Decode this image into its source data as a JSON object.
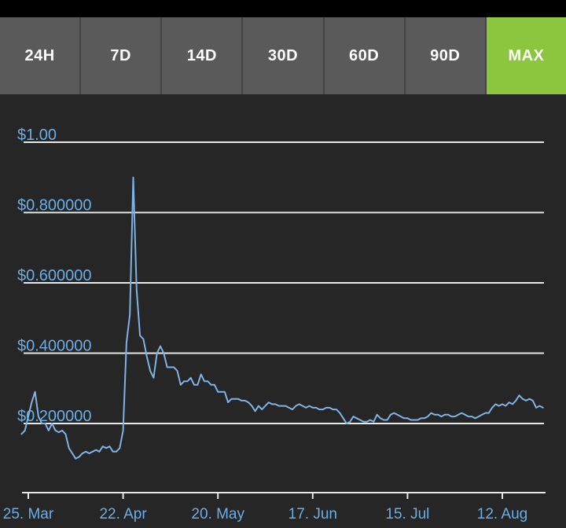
{
  "tabs": [
    {
      "label": "24H",
      "active": false
    },
    {
      "label": "7D",
      "active": false
    },
    {
      "label": "14D",
      "active": false
    },
    {
      "label": "30D",
      "active": false
    },
    {
      "label": "60D",
      "active": false
    },
    {
      "label": "90D",
      "active": false
    },
    {
      "label": "MAX",
      "active": true
    }
  ],
  "colors": {
    "background": "#262626",
    "grid": "#e8e8e8",
    "line": "#7fb2e5",
    "label": "#6aaee8",
    "tab": "#5a5a5a",
    "tab_active": "#8cc63f"
  },
  "chart_data": {
    "type": "line",
    "title": "",
    "xlabel": "",
    "ylabel": "",
    "ylim": [
      0.0,
      1.0
    ],
    "xlim": [
      "2019-03-25",
      "2019-08-24"
    ],
    "grid": true,
    "legend": "none",
    "y_ticks": [
      {
        "value": 1.0,
        "label": "$1.00"
      },
      {
        "value": 0.8,
        "label": "$0.800000"
      },
      {
        "value": 0.6,
        "label": "$0.600000"
      },
      {
        "value": 0.4,
        "label": "$0.400000"
      },
      {
        "value": 0.2,
        "label": "$0.200000"
      }
    ],
    "x_ticks": [
      {
        "date": "2019-03-25",
        "label": "25. Mar"
      },
      {
        "date": "2019-04-22",
        "label": "22. Apr"
      },
      {
        "date": "2019-05-20",
        "label": "20. May"
      },
      {
        "date": "2019-06-17",
        "label": "17. Jun"
      },
      {
        "date": "2019-07-15",
        "label": "15. Jul"
      },
      {
        "date": "2019-08-12",
        "label": "12. Aug"
      }
    ],
    "series": [
      {
        "x": [
          "2019-03-23",
          "2019-03-24",
          "2019-03-25",
          "2019-03-26",
          "2019-03-27",
          "2019-03-28",
          "2019-03-29",
          "2019-03-30",
          "2019-03-31",
          "2019-04-01",
          "2019-04-02",
          "2019-04-03",
          "2019-04-04",
          "2019-04-05",
          "2019-04-06",
          "2019-04-07",
          "2019-04-08",
          "2019-04-09",
          "2019-04-10",
          "2019-04-11",
          "2019-04-12",
          "2019-04-13",
          "2019-04-14",
          "2019-04-15",
          "2019-04-16",
          "2019-04-17",
          "2019-04-18",
          "2019-04-19",
          "2019-04-20",
          "2019-04-21",
          "2019-04-22",
          "2019-04-23",
          "2019-04-24",
          "2019-04-25",
          "2019-04-26",
          "2019-04-27",
          "2019-04-28",
          "2019-04-29",
          "2019-04-30",
          "2019-05-01",
          "2019-05-02",
          "2019-05-03",
          "2019-05-04",
          "2019-05-05",
          "2019-05-06",
          "2019-05-07",
          "2019-05-08",
          "2019-05-09",
          "2019-05-10",
          "2019-05-11",
          "2019-05-12",
          "2019-05-13",
          "2019-05-14",
          "2019-05-15",
          "2019-05-16",
          "2019-05-17",
          "2019-05-18",
          "2019-05-19",
          "2019-05-20",
          "2019-05-21",
          "2019-05-22",
          "2019-05-23",
          "2019-05-24",
          "2019-05-25",
          "2019-05-26",
          "2019-05-27",
          "2019-05-28",
          "2019-05-29",
          "2019-05-30",
          "2019-05-31",
          "2019-06-01",
          "2019-06-02",
          "2019-06-03",
          "2019-06-04",
          "2019-06-05",
          "2019-06-06",
          "2019-06-07",
          "2019-06-08",
          "2019-06-09",
          "2019-06-10",
          "2019-06-11",
          "2019-06-12",
          "2019-06-13",
          "2019-06-14",
          "2019-06-15",
          "2019-06-16",
          "2019-06-17",
          "2019-06-18",
          "2019-06-19",
          "2019-06-20",
          "2019-06-21",
          "2019-06-22",
          "2019-06-23",
          "2019-06-24",
          "2019-06-25",
          "2019-06-26",
          "2019-06-27",
          "2019-06-28",
          "2019-06-29",
          "2019-06-30",
          "2019-07-01",
          "2019-07-02",
          "2019-07-03",
          "2019-07-04",
          "2019-07-05",
          "2019-07-06",
          "2019-07-07",
          "2019-07-08",
          "2019-07-09",
          "2019-07-10",
          "2019-07-11",
          "2019-07-12",
          "2019-07-13",
          "2019-07-14",
          "2019-07-15",
          "2019-07-16",
          "2019-07-17",
          "2019-07-18",
          "2019-07-19",
          "2019-07-20",
          "2019-07-21",
          "2019-07-22",
          "2019-07-23",
          "2019-07-24",
          "2019-07-25",
          "2019-07-26",
          "2019-07-27",
          "2019-07-28",
          "2019-07-29",
          "2019-07-30",
          "2019-07-31",
          "2019-08-01",
          "2019-08-02",
          "2019-08-03",
          "2019-08-04",
          "2019-08-05",
          "2019-08-06",
          "2019-08-07",
          "2019-08-08",
          "2019-08-09",
          "2019-08-10",
          "2019-08-11",
          "2019-08-12",
          "2019-08-13",
          "2019-08-14",
          "2019-08-15",
          "2019-08-16",
          "2019-08-17",
          "2019-08-18",
          "2019-08-19",
          "2019-08-20",
          "2019-08-21",
          "2019-08-22",
          "2019-08-23",
          "2019-08-24"
        ],
        "values": [
          0.17,
          0.18,
          0.22,
          0.26,
          0.29,
          0.22,
          0.2,
          0.2,
          0.18,
          0.2,
          0.18,
          0.175,
          0.18,
          0.17,
          0.13,
          0.115,
          0.1,
          0.105,
          0.115,
          0.12,
          0.115,
          0.12,
          0.125,
          0.12,
          0.135,
          0.13,
          0.135,
          0.12,
          0.12,
          0.13,
          0.18,
          0.43,
          0.51,
          0.9,
          0.58,
          0.45,
          0.44,
          0.39,
          0.35,
          0.33,
          0.4,
          0.42,
          0.4,
          0.36,
          0.36,
          0.36,
          0.35,
          0.31,
          0.32,
          0.32,
          0.33,
          0.31,
          0.31,
          0.34,
          0.32,
          0.32,
          0.31,
          0.31,
          0.29,
          0.29,
          0.29,
          0.26,
          0.27,
          0.27,
          0.27,
          0.265,
          0.265,
          0.26,
          0.25,
          0.235,
          0.25,
          0.24,
          0.25,
          0.26,
          0.255,
          0.255,
          0.25,
          0.25,
          0.25,
          0.245,
          0.24,
          0.25,
          0.255,
          0.25,
          0.245,
          0.25,
          0.245,
          0.245,
          0.24,
          0.24,
          0.245,
          0.245,
          0.24,
          0.24,
          0.23,
          0.215,
          0.2,
          0.205,
          0.22,
          0.215,
          0.21,
          0.205,
          0.205,
          0.21,
          0.205,
          0.225,
          0.215,
          0.21,
          0.21,
          0.225,
          0.23,
          0.225,
          0.22,
          0.215,
          0.215,
          0.21,
          0.21,
          0.21,
          0.215,
          0.215,
          0.22,
          0.23,
          0.225,
          0.225,
          0.22,
          0.225,
          0.225,
          0.22,
          0.22,
          0.225,
          0.23,
          0.225,
          0.22,
          0.22,
          0.215,
          0.22,
          0.225,
          0.23,
          0.23,
          0.245,
          0.255,
          0.25,
          0.255,
          0.25,
          0.26,
          0.255,
          0.265,
          0.28,
          0.27,
          0.265,
          0.27,
          0.265,
          0.245,
          0.25,
          0.245
        ]
      }
    ]
  }
}
